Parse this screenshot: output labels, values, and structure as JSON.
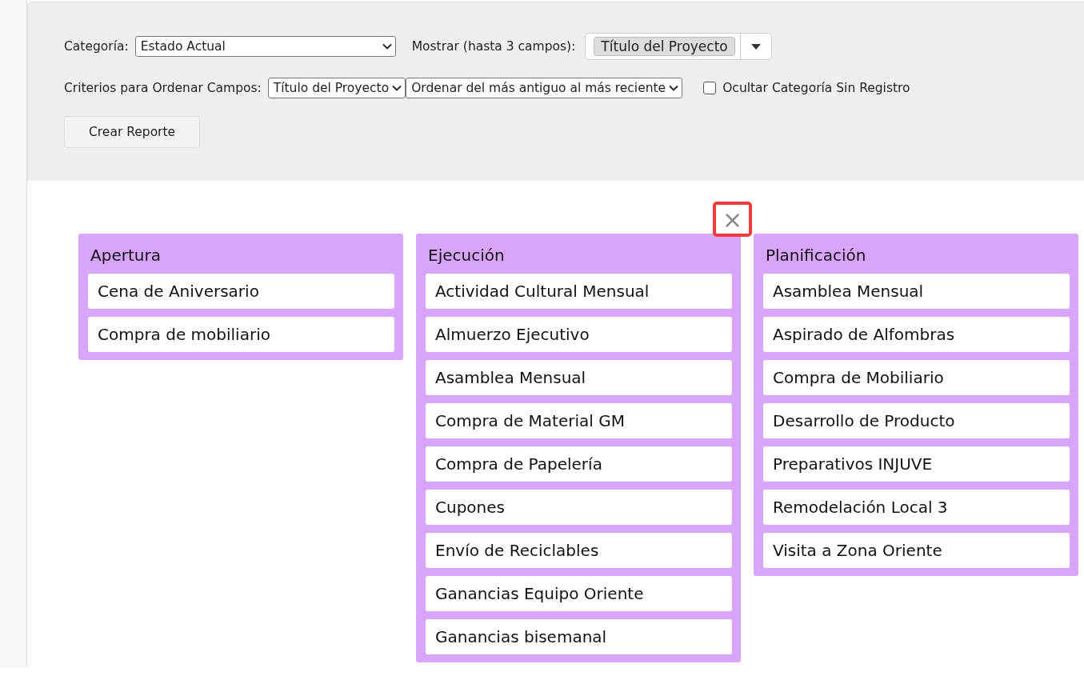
{
  "filters": {
    "category_label": "Categoría:",
    "category_value": "Estado Actual",
    "show_label": "Mostrar (hasta 3 campos):",
    "show_tags": [
      "Título del Proyecto"
    ],
    "sort_label": "Criterios para Ordenar Campos:",
    "sort_field": "Título del Proyecto",
    "sort_order": "Ordenar del más antiguo al más reciente",
    "hide_empty": {
      "label": "Ocultar Categoría Sin Registro",
      "checked": false
    },
    "create_button": "Crear Reporte"
  },
  "close_button": {
    "label": "×",
    "highlighted": true
  },
  "columns": [
    {
      "title": "Apertura",
      "cards": [
        "Cena de Aniversario",
        "Compra de mobiliario"
      ]
    },
    {
      "title": "Ejecución",
      "cards": [
        "Actividad Cultural Mensual",
        "Almuerzo Ejecutivo",
        "Asamblea Mensual",
        "Compra de Material GM",
        "Compra de Papelería",
        "Cupones",
        "Envío de Reciclables",
        "Ganancias Equipo Oriente",
        "Ganancias bisemanal"
      ]
    },
    {
      "title": "Planificación",
      "cards": [
        "Asamblea Mensual",
        "Aspirado de Alfombras",
        "Compra de Mobiliario",
        "Desarrollo de Producto",
        "Preparativos INJUVE",
        "Remodelación Local 3",
        "Visita a Zona Oriente"
      ]
    }
  ]
}
